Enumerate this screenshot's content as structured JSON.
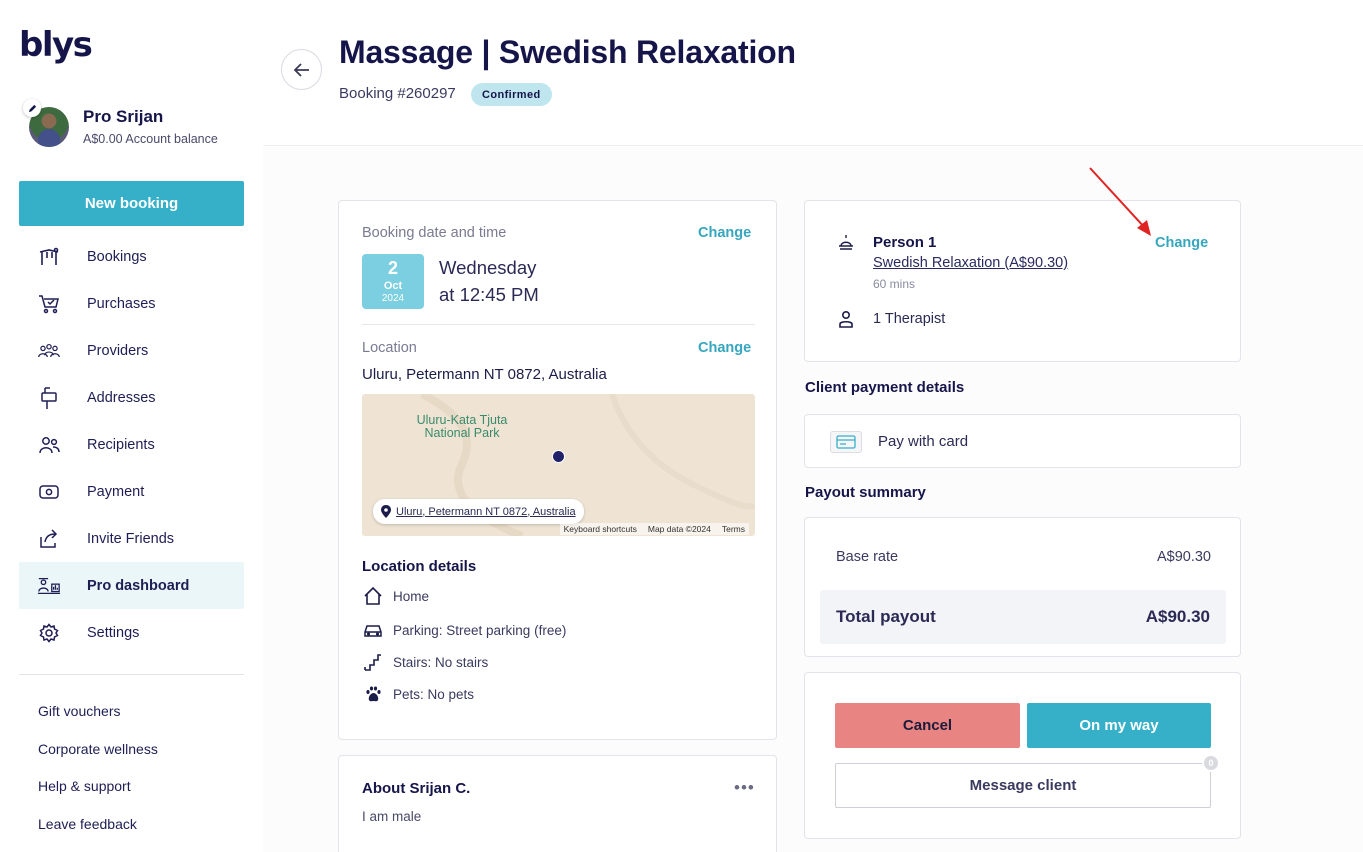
{
  "brand": {
    "logo_text": "blys",
    "accent": "#36afc9",
    "danger": "#e88583",
    "navy": "#15154a"
  },
  "profile": {
    "name": "Pro Srijan",
    "balance": "A$0.00 Account balance",
    "avatar_icon": "user-avatar",
    "edit_icon": "pencil-icon"
  },
  "sidebar": {
    "new_booking_label": "New booking",
    "items": [
      {
        "label": "Bookings",
        "icon": "bookings-icon",
        "active": false
      },
      {
        "label": "Purchases",
        "icon": "cart-icon",
        "active": false
      },
      {
        "label": "Providers",
        "icon": "providers-icon",
        "active": false
      },
      {
        "label": "Addresses",
        "icon": "mailbox-icon",
        "active": false
      },
      {
        "label": "Recipients",
        "icon": "recipients-icon",
        "active": false
      },
      {
        "label": "Payment",
        "icon": "payment-icon",
        "active": false
      },
      {
        "label": "Invite Friends",
        "icon": "share-icon",
        "active": false
      },
      {
        "label": "Pro dashboard",
        "icon": "pro-dashboard-icon",
        "active": true
      },
      {
        "label": "Settings",
        "icon": "gear-icon",
        "active": false
      }
    ],
    "links": [
      "Gift vouchers",
      "Corporate wellness",
      "Help & support",
      "Leave feedback"
    ]
  },
  "header": {
    "title": "Massage | Swedish Relaxation",
    "booking_id": "Booking #260297",
    "status": "Confirmed",
    "back_icon": "arrow-left-icon"
  },
  "booking": {
    "datetime_label": "Booking date and time",
    "change_label": "Change",
    "date": {
      "day": "2",
      "month": "Oct",
      "year": "2024"
    },
    "weekday": "Wednesday",
    "time": "at 12:45 PM",
    "location_label": "Location",
    "location_change_label": "Change",
    "address": "Uluru, Petermann NT 0872, Australia",
    "map": {
      "park_label": "Uluru-Kata Tjuta National Park",
      "chip_text": "Uluru, Petermann NT 0872, Australia",
      "footer": [
        "Keyboard shortcuts",
        "Map data ©2024",
        "Terms"
      ]
    },
    "location_details_title": "Location details",
    "location_details": [
      {
        "text": "Home",
        "icon": "home-icon"
      },
      {
        "text": "Parking: Street parking (free)",
        "icon": "car-icon"
      },
      {
        "text": "Stairs: No stairs",
        "icon": "stairs-icon"
      },
      {
        "text": "Pets: No pets",
        "icon": "paw-icon"
      }
    ]
  },
  "about": {
    "title": "About Srijan C.",
    "text": "I am male",
    "more_icon": "more-dots-icon"
  },
  "service": {
    "person": "Person 1",
    "name": "Swedish Relaxation (A$90.30)",
    "duration": "60 mins",
    "change_label": "Change",
    "therapists": "1 Therapist"
  },
  "payment": {
    "heading": "Client payment details",
    "method": "Pay with card"
  },
  "payout": {
    "heading": "Payout summary",
    "base_label": "Base rate",
    "base_value": "A$90.30",
    "total_label": "Total payout",
    "total_value": "A$90.30"
  },
  "actions": {
    "cancel": "Cancel",
    "on_my_way": "On my way",
    "message": "Message client",
    "message_count": "0"
  }
}
